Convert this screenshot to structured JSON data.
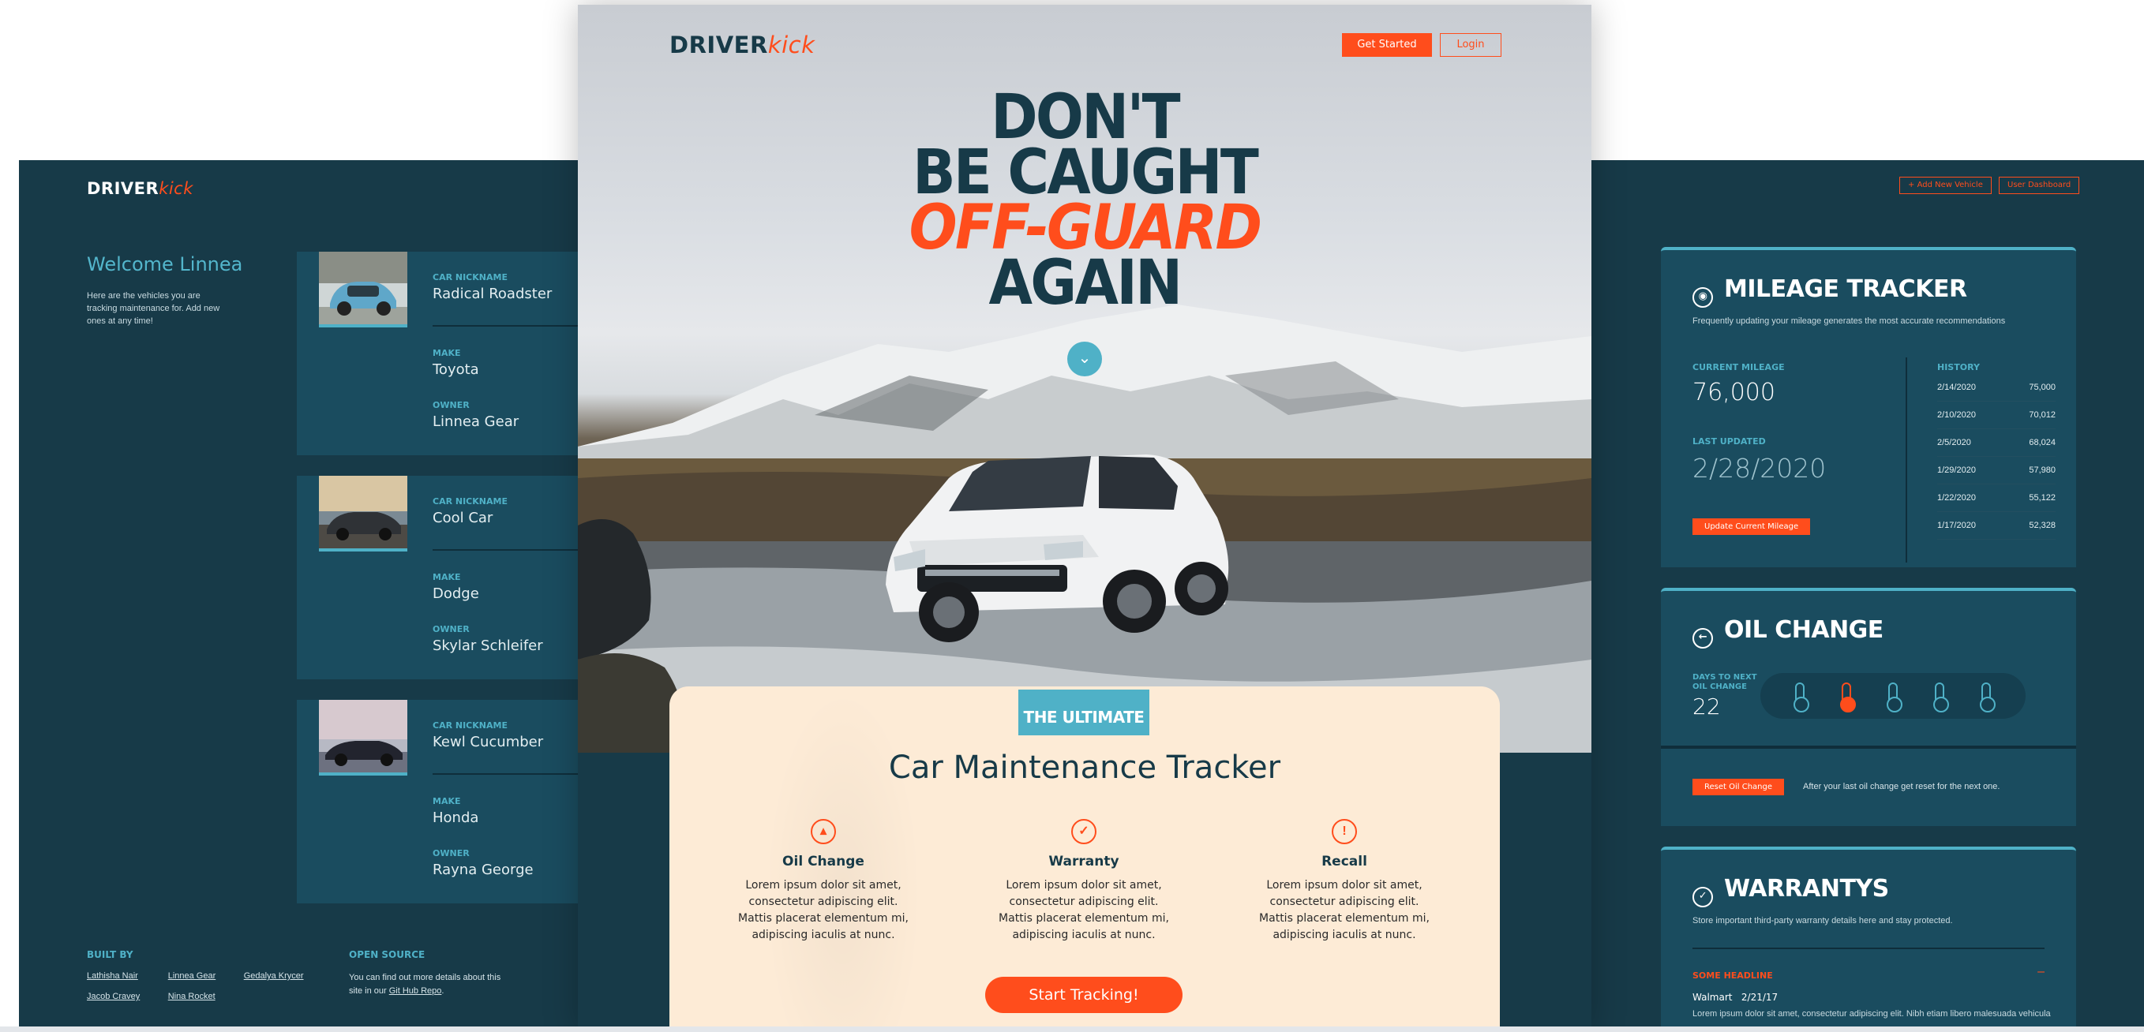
{
  "brand": {
    "name_main": "DRIVER",
    "name_accent": "kick"
  },
  "dashboard": {
    "welcome_title": "Welcome Linnea",
    "welcome_text": "Here are the vehicles you are tracking maintenance for. Add new ones at any time!",
    "labels": {
      "nickname": "CAR NICKNAME",
      "make": "MAKE",
      "owner": "OWNER"
    },
    "cars": [
      {
        "nickname": "Radical Roadster",
        "make": "Toyota",
        "owner": "Linnea Gear",
        "photo_color": "#5fa7c9"
      },
      {
        "nickname": "Cool Car",
        "make": "Dodge",
        "owner": "Skylar Schleifer",
        "photo_color": "#6b5a4a"
      },
      {
        "nickname": "Kewl Cucumber",
        "make": "Honda",
        "owner": "Rayna George",
        "photo_color": "#3a3e52"
      }
    ],
    "built_by": {
      "heading": "BUILT BY",
      "names": [
        "Lathisha Nair",
        "Linnea Gear",
        "Gedalya Krycer",
        "Jacob Cravey",
        "Nina Rocket"
      ]
    },
    "open_source": {
      "heading": "OPEN SOURCE",
      "text": "You can find out more details about this site in our ",
      "link": "Git Hub Repo",
      "suffix": "."
    }
  },
  "landing": {
    "get_started": "Get Started",
    "login": "Login",
    "headline": [
      "DON'T",
      "BE CAUGHT",
      "OFF-GUARD",
      "AGAIN"
    ],
    "scroll_icon": "chevron-down-icon",
    "badge": "THE ULTIMATE",
    "title": "Car Maintenance Tracker",
    "features": [
      {
        "icon": "oil-can-icon",
        "title": "Oil Change",
        "text": "Lorem ipsum dolor sit amet, consectetur adipiscing elit. Mattis placerat elementum mi, adipiscing iaculis at nunc."
      },
      {
        "icon": "check-circle-icon",
        "title": "Warranty",
        "text": "Lorem ipsum dolor sit amet, consectetur adipiscing elit. Mattis placerat elementum mi, adipiscing iaculis at nunc."
      },
      {
        "icon": "alert-circle-icon",
        "title": "Recall",
        "text": "Lorem ipsum dolor sit amet, consectetur adipiscing elit. Mattis placerat elementum mi, adipiscing iaculis at nunc."
      }
    ],
    "cta": "Start Tracking!"
  },
  "trackers": {
    "add_vehicle": "Add New Vehicle",
    "user_dashboard": "User Dashboard",
    "mileage": {
      "title": "MILEAGE TRACKER",
      "subtitle": "Frequently updating your mileage generates the most accurate recommendations",
      "current_label": "CURRENT MILEAGE",
      "current_value": "76,000",
      "updated_label": "LAST UPDATED",
      "updated_value": "2/28/2020",
      "button": "Update Current Mileage",
      "history_label": "HISTORY",
      "history": [
        {
          "date": "2/14/2020",
          "miles": "75,000"
        },
        {
          "date": "2/10/2020",
          "miles": "70,012"
        },
        {
          "date": "2/5/2020",
          "miles": "68,024"
        },
        {
          "date": "1/29/2020",
          "miles": "57,980"
        },
        {
          "date": "1/22/2020",
          "miles": "55,122"
        },
        {
          "date": "1/17/2020",
          "miles": "52,328"
        }
      ]
    },
    "oil": {
      "title": "OIL CHANGE",
      "days_label": "DAYS TO NEXT OIL CHANGE",
      "days_value": "22",
      "level_active_index": 2,
      "button": "Reset Oil Change",
      "note": "After your last oil change get reset for the next one."
    },
    "warranty": {
      "title": "WARRANTYS",
      "subtitle": "Store important third-party warranty details here and stay protected.",
      "headline": "SOME HEADLINE",
      "collapse": "–",
      "store": "Walmart",
      "date": "2/21/17",
      "text": "Lorem ipsum dolor sit amet, consectetur adipiscing elit. Nibh etiam libero malesuada vehicula"
    }
  },
  "colors": {
    "navy": "#173a48",
    "accent": "#ff4d1c",
    "teal": "#4fb1c7",
    "cream": "#fdebd6"
  }
}
